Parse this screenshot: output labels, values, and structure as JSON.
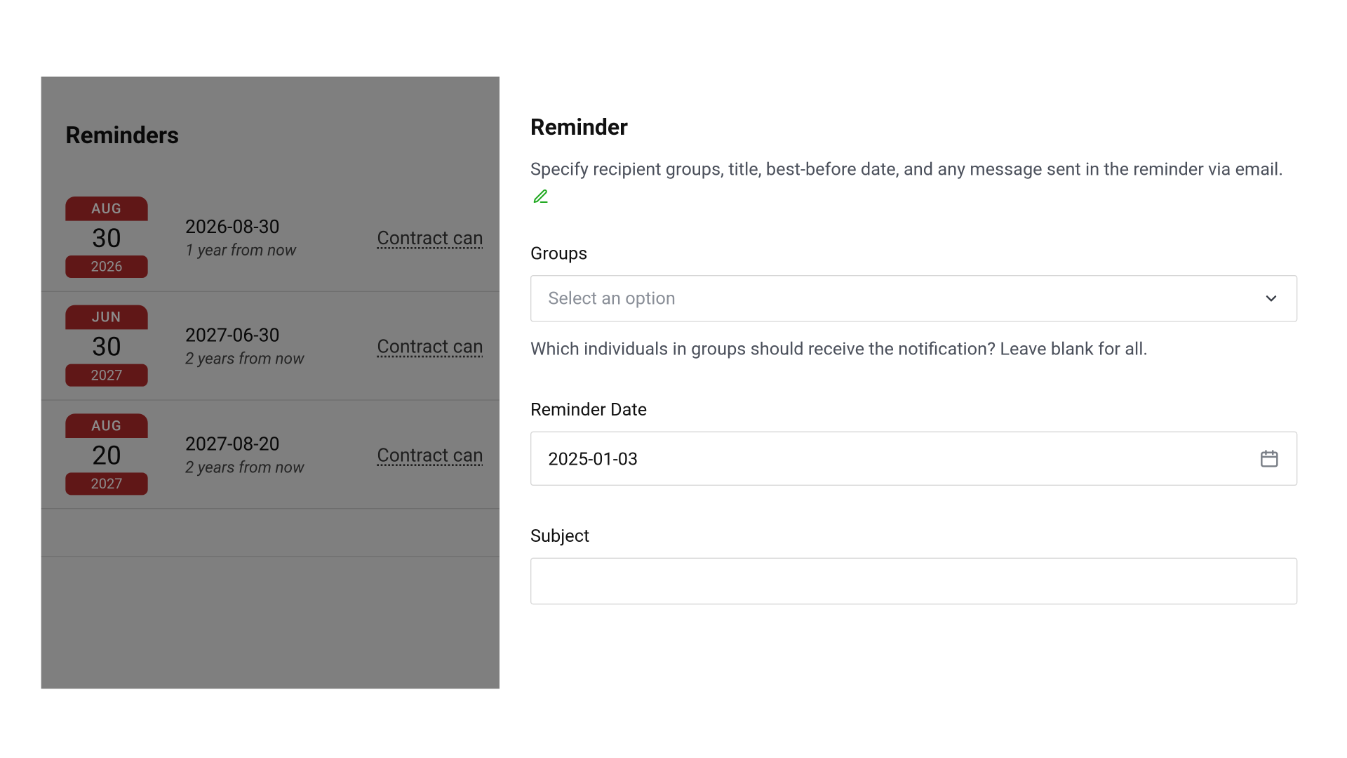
{
  "reminders_title": "Reminders",
  "reminders": [
    {
      "month": "AUG",
      "day": "30",
      "year": "2026",
      "date": "2026-08-30",
      "relative": "1 year from now",
      "link": "Contract can"
    },
    {
      "month": "JUN",
      "day": "30",
      "year": "2027",
      "date": "2027-06-30",
      "relative": "2 years from now",
      "link": "Contract can"
    },
    {
      "month": "AUG",
      "day": "20",
      "year": "2027",
      "date": "2027-08-20",
      "relative": "2 years from now",
      "link": "Contract can"
    }
  ],
  "panel": {
    "title": "Reminder",
    "description": "Specify recipient groups, title, best-before date, and any message sent in the reminder via email.",
    "groups_label": "Groups",
    "groups_placeholder": "Select an option",
    "groups_help": "Which individuals in groups should receive the notification? Leave blank for all.",
    "date_label": "Reminder Date",
    "date_value": "2025-01-03",
    "subject_label": "Subject",
    "subject_value": ""
  }
}
